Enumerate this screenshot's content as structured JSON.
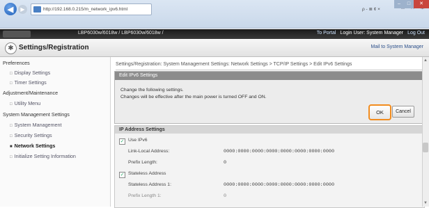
{
  "browser": {
    "url": "http://192.168.0.215/m_network_ipv6.html",
    "search_text": "ρ - ≣ ¢ ×"
  },
  "header": {
    "model": "LBP6030w/6018w / LBP6030w/6018w /",
    "to_portal": "To Portal",
    "login_user": "Login User: System Manager",
    "log_out": "Log Out"
  },
  "titlebar": {
    "title": "Settings/Registration",
    "mail_link": "Mail to System Manager"
  },
  "sidebar": {
    "items": [
      {
        "label": "Preferences",
        "type": "section"
      },
      {
        "label": "Display Settings",
        "type": "sub"
      },
      {
        "label": "Timer Settings",
        "type": "sub"
      },
      {
        "label": "Adjustment/Maintenance",
        "type": "section"
      },
      {
        "label": "Utility Menu",
        "type": "sub"
      },
      {
        "label": "System Management Settings",
        "type": "section"
      },
      {
        "label": "System Management",
        "type": "sub"
      },
      {
        "label": "Security Settings",
        "type": "sub"
      },
      {
        "label": "Network Settings",
        "type": "sub",
        "active": true
      },
      {
        "label": "Initialize Setting Information",
        "type": "sub"
      }
    ]
  },
  "main": {
    "breadcrumb": "Settings/Registration: System Management Settings: Network Settings > TCP/IP Settings > Edit IPv6 Settings",
    "edit_panel": {
      "title": "Edit IPv6 Settings",
      "line1": "Change the following settings.",
      "line2": "Changes will be effective after the main power is turned OFF and ON.",
      "ok": "OK",
      "cancel": "Cancel"
    },
    "ip_panel": {
      "title": "IP Address Settings",
      "use_ipv6": "Use IPv6",
      "link_local_label": "Link-Local Address:",
      "link_local_value": "0000:0000:0000:0000:0000:0000:0000:0000",
      "prefix_label": "Prefix Length:",
      "prefix_value": "0",
      "stateless_label": "Stateless Address",
      "stateless1_label": "Stateless Address 1:",
      "stateless1_value": "0000:0000:0000:0000:0000:0000:0000:0000",
      "prefix1_label": "Prefix Length 1:",
      "prefix1_value": "0"
    }
  },
  "colors": {
    "ok_highlight": "#f28c1e",
    "header_bg": "#222222",
    "panel_head": "#8c8c8c"
  }
}
